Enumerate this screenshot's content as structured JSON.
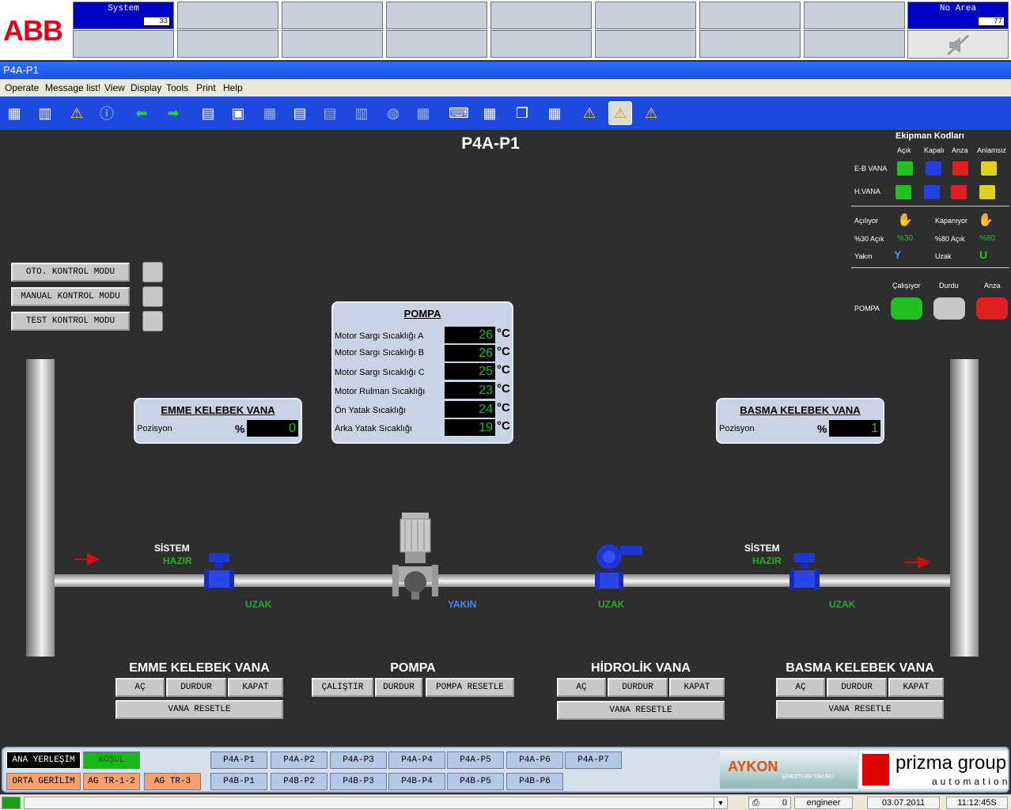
{
  "top": {
    "logo": "ABB",
    "system_label": "System",
    "system_count": "33",
    "area_label": "No Area",
    "area_count": "77"
  },
  "window": {
    "title": "P4A-P1"
  },
  "menu": [
    "Operate",
    "Message list!",
    "View",
    "Display",
    "Tools",
    "Print",
    "Help"
  ],
  "page_title": "P4A-P1",
  "modes": [
    {
      "label": "OTO. KONTROL MODU"
    },
    {
      "label": "MANUAL KONTROL MODU"
    },
    {
      "label": "TEST KONTROL MODU"
    }
  ],
  "pompa_panel": {
    "title": "POMPA",
    "rows": [
      {
        "label": "Motor Sargı Sıcaklığı A",
        "value": "26",
        "unit": "°C"
      },
      {
        "label": "Motor Sargı Sıcaklığı B",
        "value": "26",
        "unit": "°C"
      },
      {
        "label": "Motor Sargı Sıcaklığı C",
        "value": "25",
        "unit": "°C"
      },
      {
        "label": "Motor Rulman Sıcaklığı",
        "value": "23",
        "unit": "°C"
      },
      {
        "label": "Ön Yatak Sıcaklığı",
        "value": "24",
        "unit": "°C"
      },
      {
        "label": "Arka Yatak Sıcaklığı",
        "value": "19",
        "unit": "°C"
      }
    ]
  },
  "emme_panel": {
    "title": "EMME KELEBEK VANA",
    "label": "Pozisyon",
    "unit": "%",
    "value": "0"
  },
  "basma_panel": {
    "title": "BASMA KELEBEK VANA",
    "label": "Pozisyon",
    "unit": "%",
    "value": "1"
  },
  "process": {
    "sistem_left": "SİSTEM",
    "hazir_left": "HAZIR",
    "sistem_right": "SİSTEM",
    "hazir_right": "HAZIR",
    "uzak1": "UZAK",
    "yakin": "YAKIN",
    "uzak2": "UZAK",
    "uzak3": "UZAK"
  },
  "controls": {
    "emme": {
      "title": "EMME KELEBEK VANA",
      "ac": "AÇ",
      "durdur": "DURDUR",
      "kapat": "KAPAT",
      "reset": "VANA RESETLE"
    },
    "pompa": {
      "title": "POMPA",
      "calistir": "ÇALIŞTIR",
      "durdur": "DURDUR",
      "reset": "POMPA RESETLE"
    },
    "hidrolik": {
      "title": "HİDROLİK VANA",
      "ac": "AÇ",
      "durdur": "DURDUR",
      "kapat": "KAPAT",
      "reset": "VANA RESETLE"
    },
    "basma": {
      "title": "BASMA KELEBEK VANA",
      "ac": "AÇ",
      "durdur": "DURDUR",
      "kapat": "KAPAT",
      "reset": "VANA RESETLE"
    }
  },
  "legend": {
    "title": "Ekipman Kodları",
    "cols": [
      "Açık",
      "Kapalı",
      "Anza",
      "Anlamsız"
    ],
    "eb_vana": "E-B VANA",
    "h_vana": "H.VANA",
    "aciliyor": "Açılıyor",
    "kapaniyor": "Kapanıyor",
    "acik30": "%30 Açık",
    "acik30_v": "%30",
    "acik80": "%80 Açık",
    "acik80_v": "%80",
    "yakin": "Yakın",
    "yakin_v": "Y",
    "uzak": "Uzak",
    "uzak_v": "U",
    "pompa_cols": [
      "Çalışıyor",
      "Durdu",
      "Anza"
    ],
    "pompa": "POMPA",
    "colors": {
      "open": "#22c022",
      "closed": "#2040e0",
      "fault": "#e02020",
      "meaningless": "#e0d020"
    }
  },
  "nav": {
    "row1": [
      "ANA YERLEŞİM",
      "KOŞUL"
    ],
    "row2": [
      "ORTA GERİLİM",
      "AG TR-1-2",
      "AG TR-3"
    ],
    "p4a": [
      "P4A-P1",
      "P4A-P2",
      "P4A-P3",
      "P4A-P4",
      "P4A-P5",
      "P4A-P6",
      "P4A-P7"
    ],
    "p4b": [
      "P4B-P1",
      "P4B-P2",
      "P4B-P3",
      "P4B-P4",
      "P4B-P5",
      "P4B-P6"
    ],
    "logo1": "AYKON",
    "logo1_sub": "ŞİRKETLER GRUBU",
    "logo2": "prizma group",
    "logo2_sub": "automation"
  },
  "status": {
    "count": "0",
    "user": "engineer",
    "date": "03.07.2011",
    "time": "11:12:45S"
  }
}
